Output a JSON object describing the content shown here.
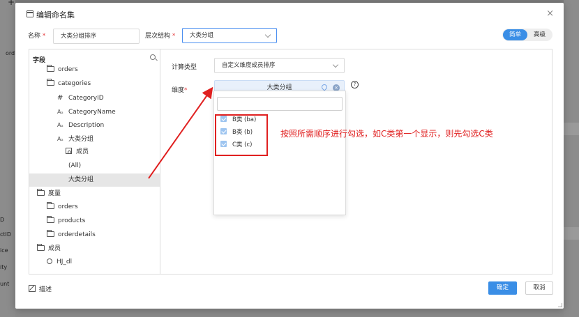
{
  "background": {
    "left_labels": [
      "ord",
      "D",
      "ctID",
      "ice",
      "ity",
      "unt"
    ],
    "plus": "+"
  },
  "dialog": {
    "title": "编辑命名集",
    "close": "×",
    "name_label": "名称",
    "name_value": "大类分组排序",
    "hierarchy_label": "层次结构",
    "hierarchy_value": "大类分组",
    "mode_simple": "简单",
    "mode_advanced": "高级",
    "required_mark": "*"
  },
  "tree": {
    "header": "字段",
    "nodes": [
      {
        "label": "orders",
        "icon": "folder"
      },
      {
        "label": "categories",
        "icon": "folder-open"
      },
      {
        "label": "CategoryID",
        "icon": "hash"
      },
      {
        "label": "CategoryName",
        "icon": "text"
      },
      {
        "label": "Description",
        "icon": "text"
      },
      {
        "label": "大类分组",
        "icon": "text"
      },
      {
        "label": "成员",
        "icon": "member"
      },
      {
        "label": "(All)",
        "icon": "none"
      },
      {
        "label": "大类分组",
        "icon": "none",
        "selected": true
      },
      {
        "label": "度量",
        "icon": "folder-open"
      },
      {
        "label": "orders",
        "icon": "folder"
      },
      {
        "label": "products",
        "icon": "folder"
      },
      {
        "label": "orderdetails",
        "icon": "folder"
      },
      {
        "label": "成员",
        "icon": "folder-open"
      },
      {
        "label": "HJ_dl",
        "icon": "circle"
      }
    ],
    "icon_text": "Aₐ",
    "icon_hash": "#"
  },
  "form": {
    "calc_type_label": "计算类型",
    "calc_type_value": "自定义维度成员排序",
    "dimension_label": "维度",
    "dimension_value": "大类分组",
    "help": "?"
  },
  "dropdown": {
    "items": [
      "B类 (ba)",
      "B类 (b)",
      "C类 (c)"
    ]
  },
  "annotation": "按照所需顺序进行勾选，如C类第一个显示，则先勾选C类",
  "footer": {
    "desc_label": "描述",
    "ok_label": "确定",
    "cancel_label": "取消"
  },
  "colors": {
    "accent": "#3a8ee6",
    "annotation": "#e02020"
  }
}
